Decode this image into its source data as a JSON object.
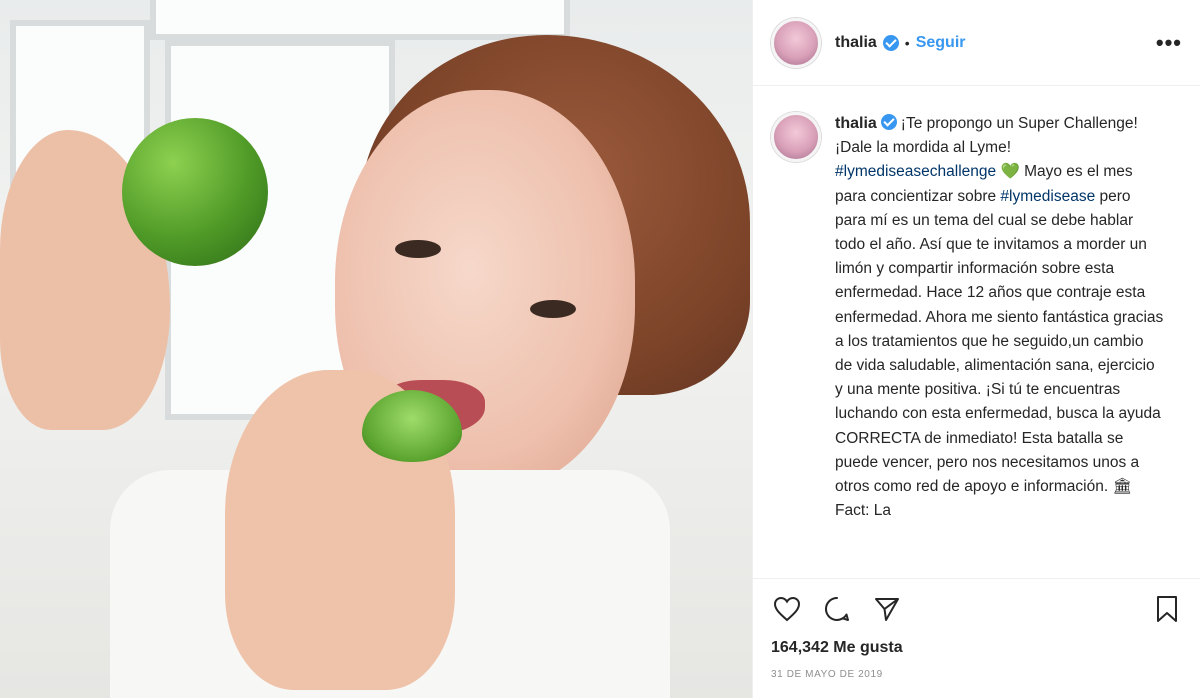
{
  "post": {
    "username": "thalia",
    "follow_label": "Seguir",
    "separator": "•",
    "more_label": "•••"
  },
  "caption": {
    "username": "thalia",
    "text_1": "¡Te propongo un Super Challenge! ¡Dale la mordida al Lyme! ",
    "hashtag_1": "#lymediseasechallenge",
    "emoji_1": "💚",
    "text_2": " Mayo es el mes para concientizar sobre ",
    "hashtag_2": "#lymedisease",
    "text_3": " pero para mí es un tema del cual se debe hablar todo el año. Así que te invitamos a morder un limón y compartir información sobre esta enfermedad. Hace 12 años que contraje esta enfermedad. Ahora me siento fantástica gracias a los tratamientos que he seguido,un cambio de vida saludable, alimentación sana, ejercicio y una mente positiva. ¡Si tú te encuentras luchando con esta enfermedad, busca la ayuda CORRECTA de inmediato! Esta batalla se puede vencer, pero nos necesitamos unos a otros como red de apoyo e información. ",
    "emoji_2": "🏛",
    "text_4": " Fact: La"
  },
  "stats": {
    "likes": "164,342 Me gusta",
    "date": "31 DE MAYO DE 2019"
  },
  "icons": {
    "like": "heart-icon",
    "comment": "comment-icon",
    "share": "share-icon",
    "save": "bookmark-icon",
    "verified": "verified-badge-icon"
  },
  "colors": {
    "link_blue": "#3897f0",
    "hashtag": "#003569",
    "text": "#262626",
    "muted": "#8e8e8e"
  }
}
